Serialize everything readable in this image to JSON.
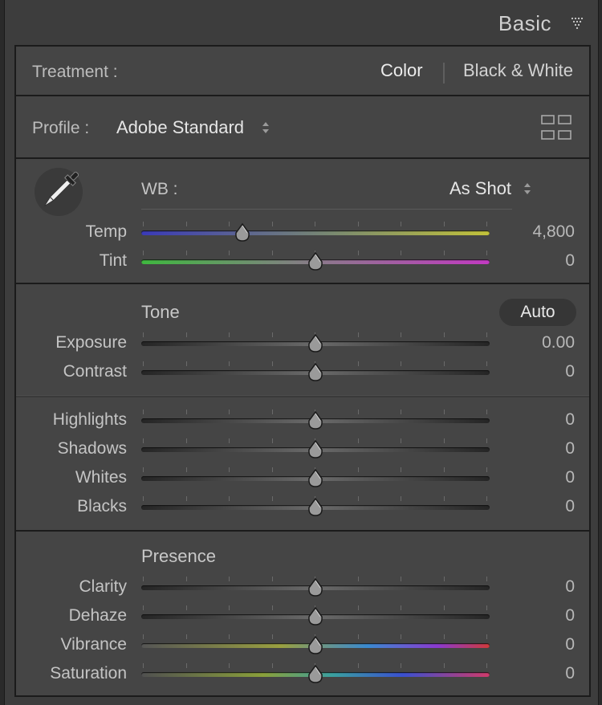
{
  "header": {
    "title": "Basic"
  },
  "treatment": {
    "label": "Treatment :",
    "color": "Color",
    "bw": "Black & White"
  },
  "profile": {
    "label": "Profile :",
    "value": "Adobe Standard"
  },
  "wb": {
    "label": "WB :",
    "value": "As Shot",
    "sliders": [
      {
        "label": "Temp",
        "value": "4,800",
        "level": 0.29,
        "style": "temp"
      },
      {
        "label": "Tint",
        "value": "0",
        "level": 0.5,
        "style": "tint"
      }
    ]
  },
  "tone": {
    "title": "Tone",
    "auto_label": "Auto",
    "sliders": [
      {
        "label": "Exposure",
        "value": "0.00",
        "level": 0.5,
        "style": "gray"
      },
      {
        "label": "Contrast",
        "value": "0",
        "level": 0.5,
        "style": "gray"
      },
      {
        "label": "Highlights",
        "value": "0",
        "level": 0.5,
        "style": "gray"
      },
      {
        "label": "Shadows",
        "value": "0",
        "level": 0.5,
        "style": "gray"
      },
      {
        "label": "Whites",
        "value": "0",
        "level": 0.5,
        "style": "gray"
      },
      {
        "label": "Blacks",
        "value": "0",
        "level": 0.5,
        "style": "gray"
      }
    ]
  },
  "presence": {
    "title": "Presence",
    "sliders": [
      {
        "label": "Clarity",
        "value": "0",
        "level": 0.5,
        "style": "gray"
      },
      {
        "label": "Dehaze",
        "value": "0",
        "level": 0.5,
        "style": "gray"
      },
      {
        "label": "Vibrance",
        "value": "0",
        "level": 0.5,
        "style": "vib"
      },
      {
        "label": "Saturation",
        "value": "0",
        "level": 0.5,
        "style": "sat"
      }
    ]
  },
  "icons": {
    "collapse": "triangle-down-icon",
    "eyedropper": "eyedropper-icon",
    "stepper": "up-down-stepper-icon",
    "grid": "profile-browser-grid-icon"
  },
  "colors": {
    "panel_bg": "#3d3d3d",
    "section_bg": "#454545",
    "text": "#c4c4c4"
  }
}
